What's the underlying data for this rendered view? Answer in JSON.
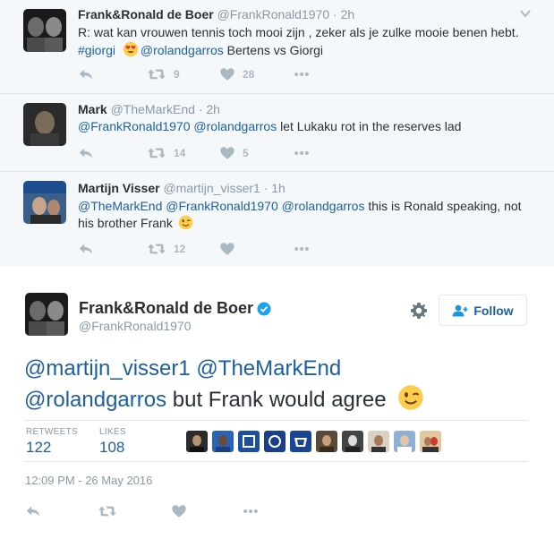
{
  "replies": [
    {
      "name": "Frank&Ronald de Boer",
      "handle": "@FrankRonald1970",
      "separator": "·",
      "time": "2h",
      "text_line1": "R: wat kan vrouwen tennis toch mooi zijn , zeker als je zulke mooie benen hebt.",
      "tag": "#giorgi",
      "mention": "@rolandgarros",
      "tail": " Bertens vs Giorgi",
      "retweets": "9",
      "likes": "28"
    },
    {
      "name": "Mark",
      "handle": "@TheMarkEnd",
      "separator": "·",
      "time": "2h",
      "mention1": "@FrankRonald1970",
      "mention2": "@rolandgarros",
      "tail": " let Lukaku rot in the reserves lad",
      "retweets": "14",
      "likes": "5"
    },
    {
      "name": "Martijn Visser",
      "handle": "@martijn_visser1",
      "separator": "·",
      "time": "1h",
      "mention1": "@TheMarkEnd",
      "mention2": "@FrankRonald1970",
      "mention3": "@rolandgarros",
      "tail": " this is Ronald speaking, not",
      "line2": "his brother Frank",
      "retweets": "12",
      "likes": ""
    }
  ],
  "main": {
    "name": "Frank&Ronald de Boer",
    "handle": "@FrankRonald1970",
    "follow_label": "Follow",
    "mention1": "@martijn_visser1",
    "mention2": "@TheMarkEnd",
    "mention3": "@rolandgarros",
    "text_tail": " but Frank would agree",
    "retweets_label": "RETWEETS",
    "retweets": "122",
    "likes_label": "LIKES",
    "likes": "108",
    "timestamp": "12:09 PM - 26 May 2016"
  },
  "colors": {
    "link": "#1b5f9e",
    "muted": "#8899a6",
    "icon": "#aab8c2",
    "verified": "#1da1f2",
    "retweet_highlight": "#19cf86",
    "thread_bg": "#f5f8fa"
  },
  "icons": {
    "reply": "reply-icon",
    "retweet": "retweet-icon",
    "like": "heart-icon",
    "more": "more-icon",
    "verified": "verified-badge-icon",
    "gear": "gear-icon",
    "follow": "follow-user-icon",
    "chevron": "chevron-down-icon"
  }
}
